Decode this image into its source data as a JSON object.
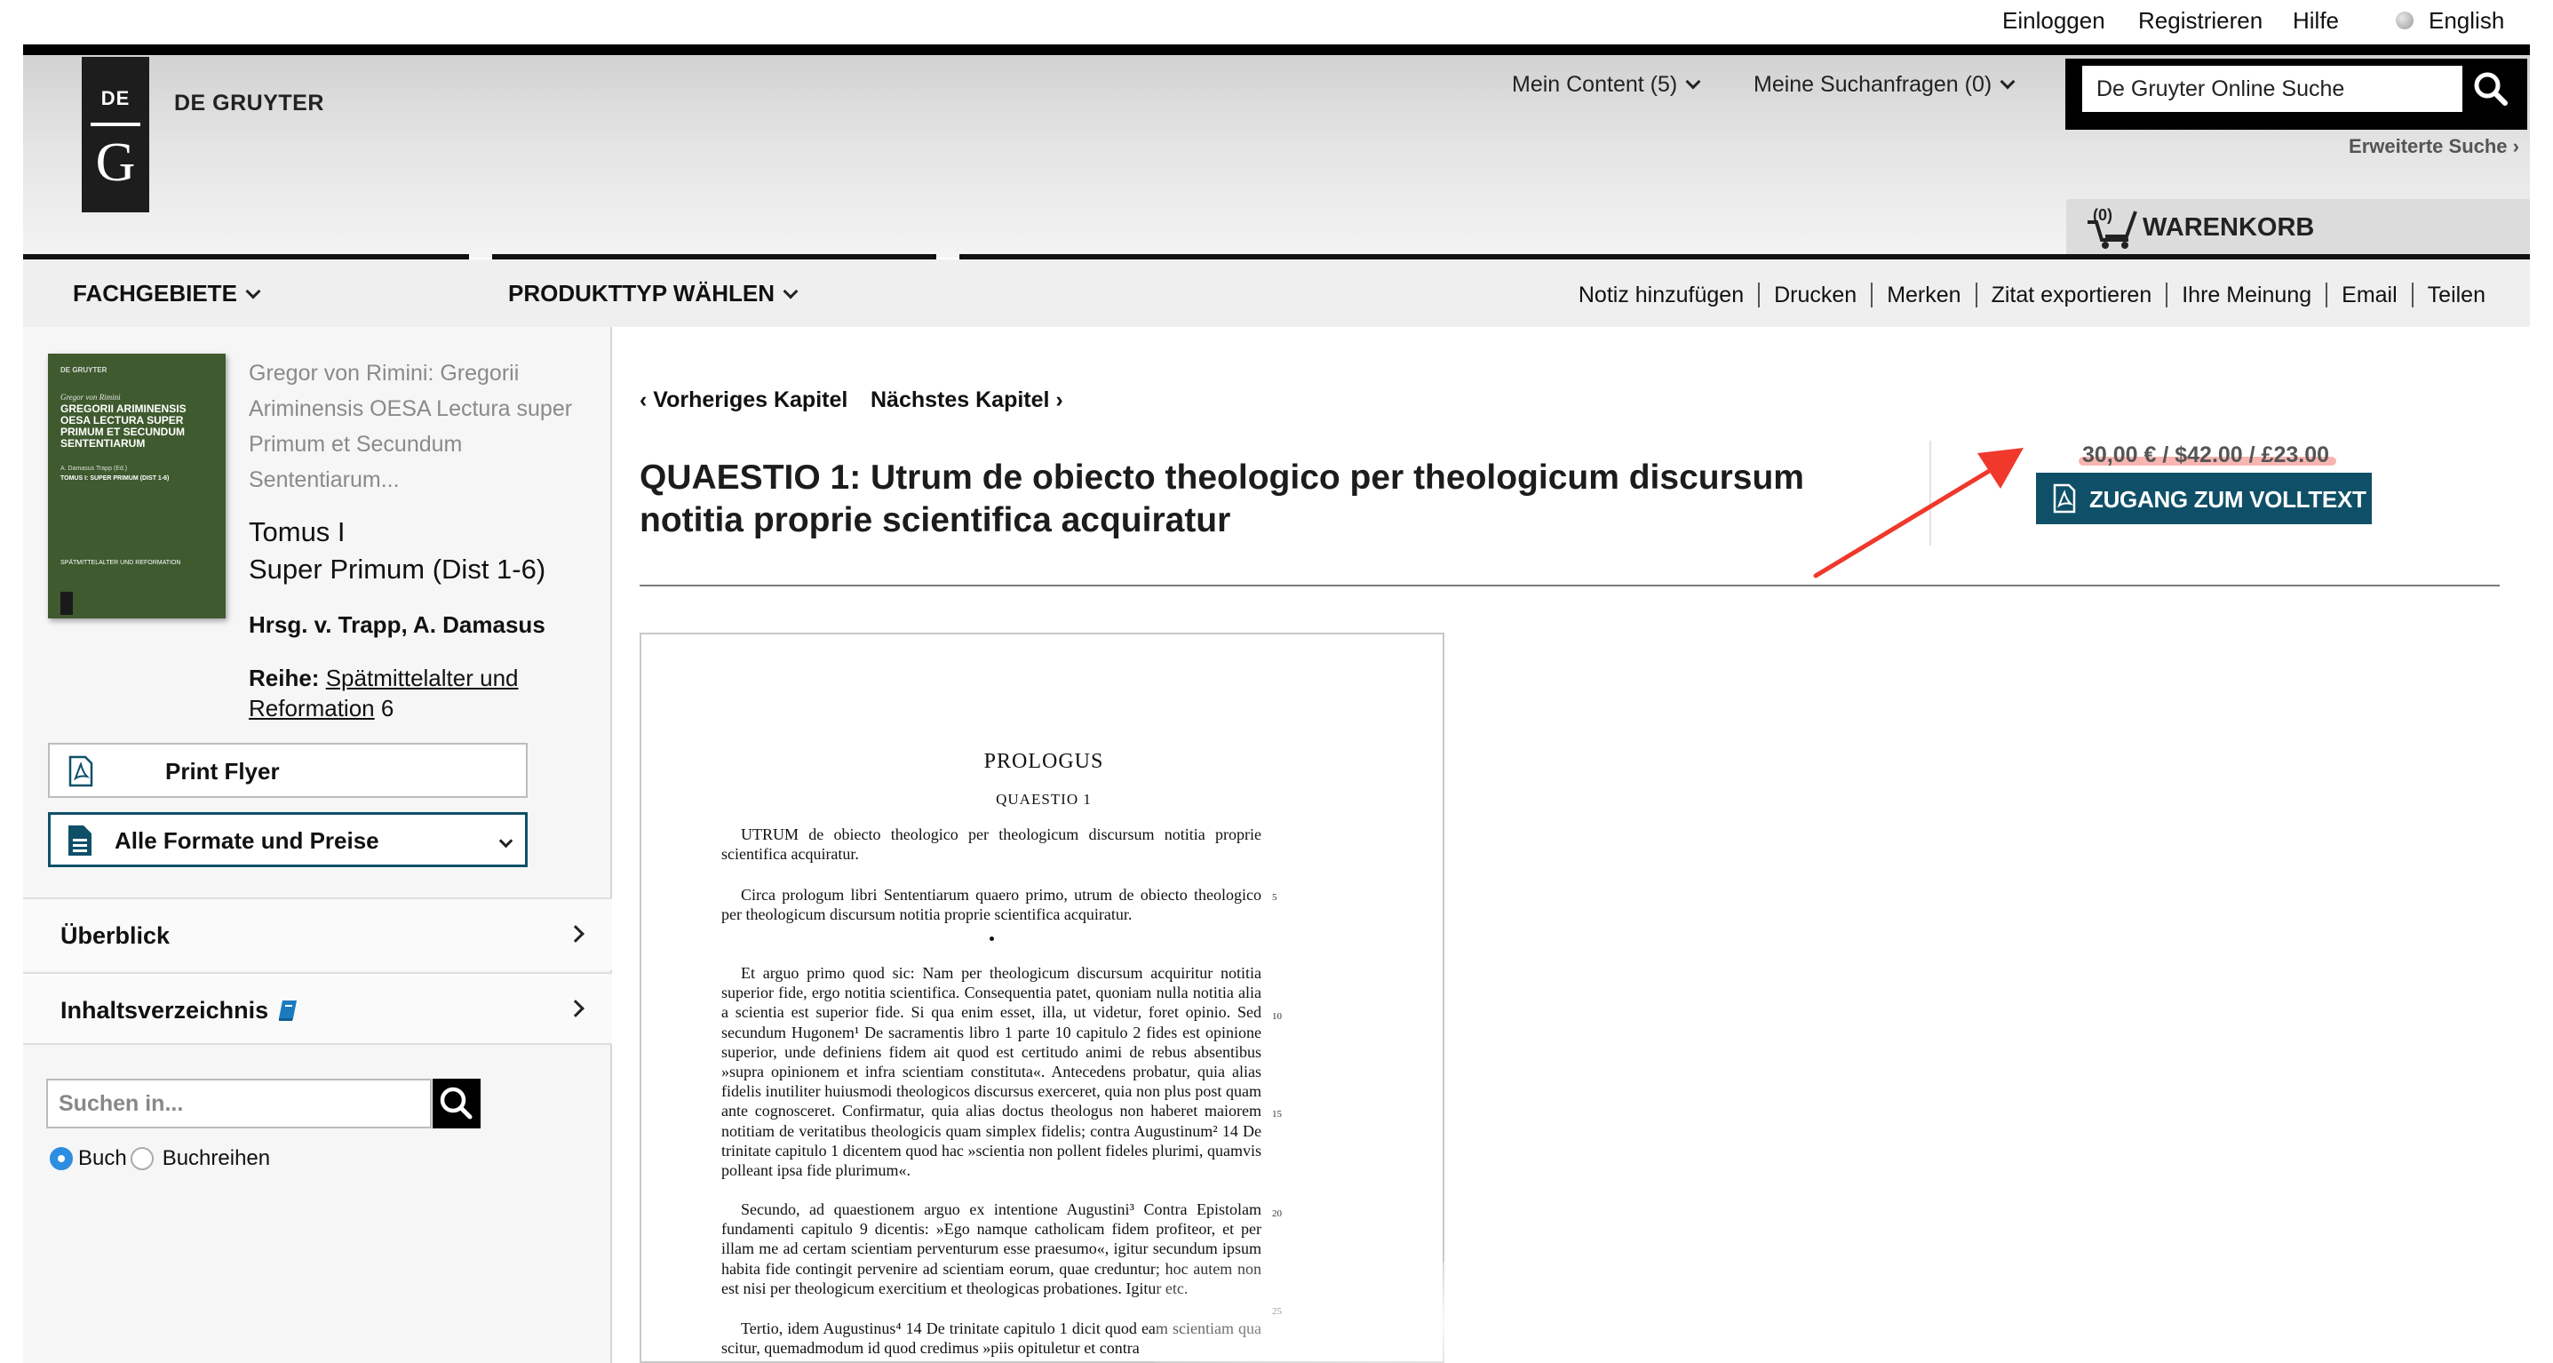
{
  "topnav": {
    "login": "Einloggen",
    "register": "Registrieren",
    "help": "Hilfe",
    "language": "English"
  },
  "brand": {
    "logo_top": "DE",
    "logo_bottom": "G",
    "name": "DE GRUYTER"
  },
  "header": {
    "my_content": "Mein Content (5)",
    "my_searches": "Meine Suchanfragen (0)",
    "search_value": "De Gruyter Online Suche",
    "advanced_search": "Erweiterte Suche",
    "cart_count": "(0)",
    "cart_label": "WARENKORB"
  },
  "catbar": {
    "subjects": "FACHGEBIETE",
    "product_type": "PRODUKTTYP WÄHLEN",
    "tools": [
      "Notiz hinzufügen",
      "Drucken",
      "Merken",
      "Zitat exportieren",
      "Ihre Meinung",
      "Email",
      "Teilen"
    ]
  },
  "book": {
    "cover_publisher": "DE GRUYTER",
    "cover_author": "Gregor von Rimini",
    "cover_title": "GREGORII ARIMINENSIS OESA LECTURA SUPER PRIMUM ET SECUNDUM SENTENTIARUM",
    "cover_editor": "A. Damasus Trapp (Ed.)",
    "cover_volume": "TOMUS I: SUPER PRIMUM (DIST 1-6)",
    "cover_series": "SPÄTMITTELALTER UND REFORMATION",
    "full_title": "Gregor von Rimini: Gregorii Ariminensis OESA Lectura super Primum et Secundum Sententiarum...",
    "volume": "Tomus I",
    "volume_sub": "Super Primum (Dist 1-6)",
    "editors": "Hrsg. v. Trapp, A. Damasus",
    "series_label": "Reihe:",
    "series_name": "Spätmittelalter und Reformation",
    "series_number": "6"
  },
  "sidebar": {
    "print_flyer": "Print Flyer",
    "all_formats": "Alle Formate und Preise",
    "overview": "Überblick",
    "toc": "Inhaltsverzeichnis",
    "search_placeholder": "Suchen in...",
    "radio_book": "Buch",
    "radio_series": "Buchreihen"
  },
  "main": {
    "prev_chapter": "Vorheriges Kapitel",
    "next_chapter": "Nächstes Kapitel",
    "chapter_title": "QUAESTIO 1: Utrum de obiecto theologico per theologicum discursum notitia proprie scientifica acquiratur",
    "price": "30,00 € / $42.00 / £23.00",
    "access_button": "ZUGANG ZUM VOLLTEXT"
  },
  "preview": {
    "heading": "PROLOGUS",
    "subheading": "QUAESTIO 1",
    "paragraphs": [
      "UTRUM de obiecto theologico per theologicum discursum notitia proprie scientifica acquiratur.",
      "Circa prologum libri Sententiarum quaero primo, utrum de obiecto theologico per theologicum discursum notitia proprie scientifica acquiratur.",
      "Et arguo primo quod sic: Nam per theologicum discursum acquiritur notitia superior fide, ergo notitia scientifica. Consequentia patet, quoniam nulla notitia alia a scientia est superior fide. Si qua enim esset, illa, ut videtur, foret opinio. Sed secundum Hugonem¹ De sacramentis libro 1 parte 10 capitulo 2 fides est opinione superior, unde definiens fidem ait quod est certitudo animi de rebus absentibus »supra opinionem et infra scientiam constituta«. Antecedens probatur, quia alias fidelis inutiliter huiusmodi theologicos discursus exerceret, quia non plus post quam ante cognosceret. Confirmatur, quia alias doctus theologus non haberet maiorem notitiam de veritatibus theologicis quam simplex fidelis; contra Augustinum² 14 De trinitate capitulo 1 dicentem quod hac »scientia non pollent fideles plurimi, quamvis polleant ipsa fide plurimum«.",
      "Secundo, ad quaestionem arguo ex intentione Augustini³ Contra Epistolam fundamenti capitulo 9 dicentis: »Ego namque catholicam fidem profiteor, et per illam me ad certam scientiam perventurum esse praesumo«, igitur secundum ipsum habita fide contingit pervenire ad scientiam eorum, quae creduntur; hoc autem non est nisi per theologicum exercitium et theologicas probationes. Igitur etc.",
      "Tertio, idem Augustinus⁴ 14 De trinitate capitulo 1 dicit quod eam scientiam qua scitur, quemadmodum id quod credimus »piis opituletur et contra"
    ],
    "line_numbers": [
      "5",
      "10",
      "15",
      "20",
      "25"
    ]
  }
}
